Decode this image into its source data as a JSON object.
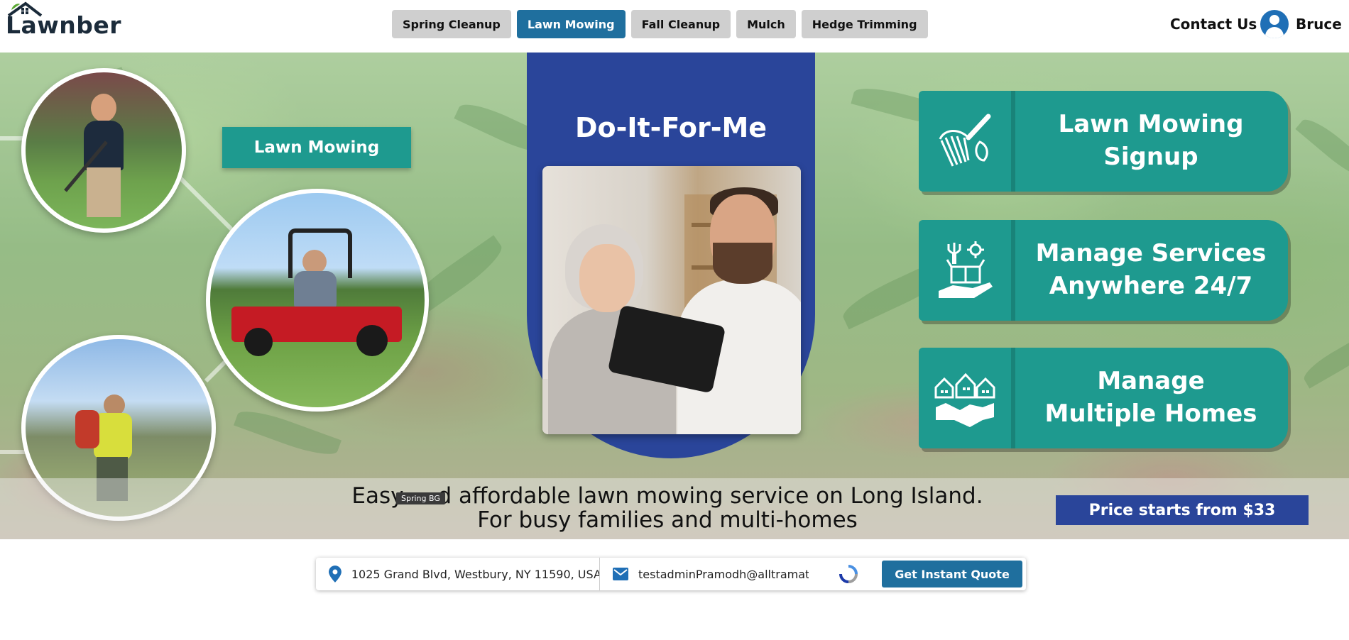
{
  "brand": {
    "name": "Lawnber"
  },
  "nav": {
    "items": [
      {
        "label": "Spring Cleanup",
        "active": false
      },
      {
        "label": "Lawn Mowing",
        "active": true
      },
      {
        "label": "Fall Cleanup",
        "active": false
      },
      {
        "label": "Mulch",
        "active": false
      },
      {
        "label": "Hedge Trimming",
        "active": false
      }
    ],
    "contact_label": "Contact Us",
    "user_name": "Bruce"
  },
  "hero": {
    "service_label": "Lawn Mowing",
    "difm_title": "Do-It-For-Me",
    "cta": [
      {
        "label": "Lawn Mowing\nSignup",
        "icon": "rake-leaf-icon"
      },
      {
        "label": "Manage Services\nAnywhere 24/7",
        "icon": "tools-box-hand-icon"
      },
      {
        "label": "Manage\nMultiple Homes",
        "icon": "houses-handshake-icon"
      }
    ],
    "tagline_line1_start": "Easy",
    "tagline_line1_end": "d affordable lawn mowing service on Long Island.",
    "tagline_line2": "For busy families and multi-homes",
    "tooltip": "Spring BG",
    "price": "Price starts from $33"
  },
  "quote": {
    "address": "1025 Grand Blvd, Westbury, NY 11590, USA",
    "email": "testadminPramodh@alltramatic.com",
    "button_label": "Get Instant Quote"
  },
  "colors": {
    "teal": "#1e9a8f",
    "navy": "#2a459a",
    "blue_button": "#1f6f9e",
    "nav_inactive": "#cfcfcf"
  }
}
